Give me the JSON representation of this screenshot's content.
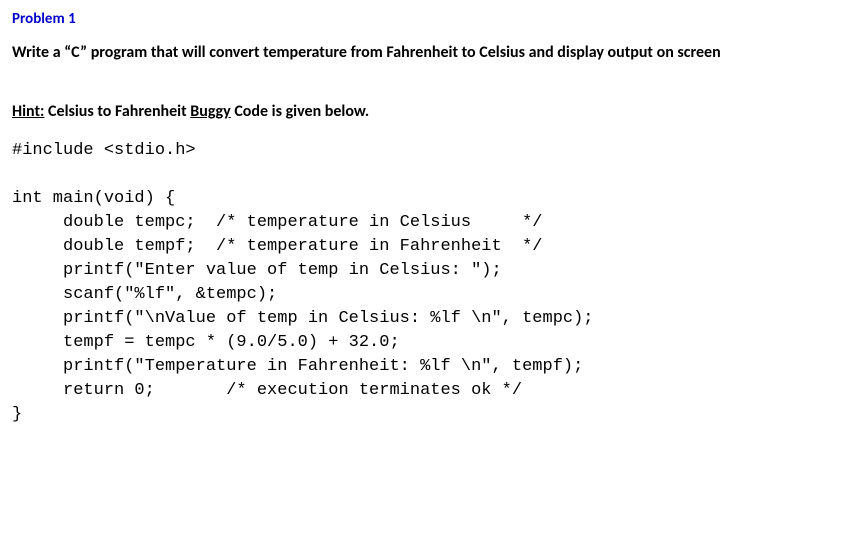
{
  "title": "Problem 1",
  "statement": "Write a “C” program that will convert temperature from Fahrenheit to Celsius and display output on screen",
  "hint": {
    "label": "Hint:",
    "mid": " Celsius to Fahrenheit ",
    "buggy": "Buggy",
    "tail": " Code is given below."
  },
  "code": {
    "l1": "#include <stdio.h>",
    "l2": "",
    "l3": "int main(void) {",
    "l4": "     double tempc;  /* temperature in Celsius     */",
    "l5": "     double tempf;  /* temperature in Fahrenheit  */",
    "l6": "     printf(\"Enter value of temp in Celsius: \");",
    "l7": "     scanf(\"%lf\", &tempc);",
    "l8": "     printf(\"\\nValue of temp in Celsius: %lf \\n\", tempc);",
    "l9": "     tempf = tempc * (9.0/5.0) + 32.0;",
    "l10": "     printf(\"Temperature in Fahrenheit: %lf \\n\", tempf);",
    "l11": "     return 0;       /* execution terminates ok */",
    "l12": "}"
  }
}
